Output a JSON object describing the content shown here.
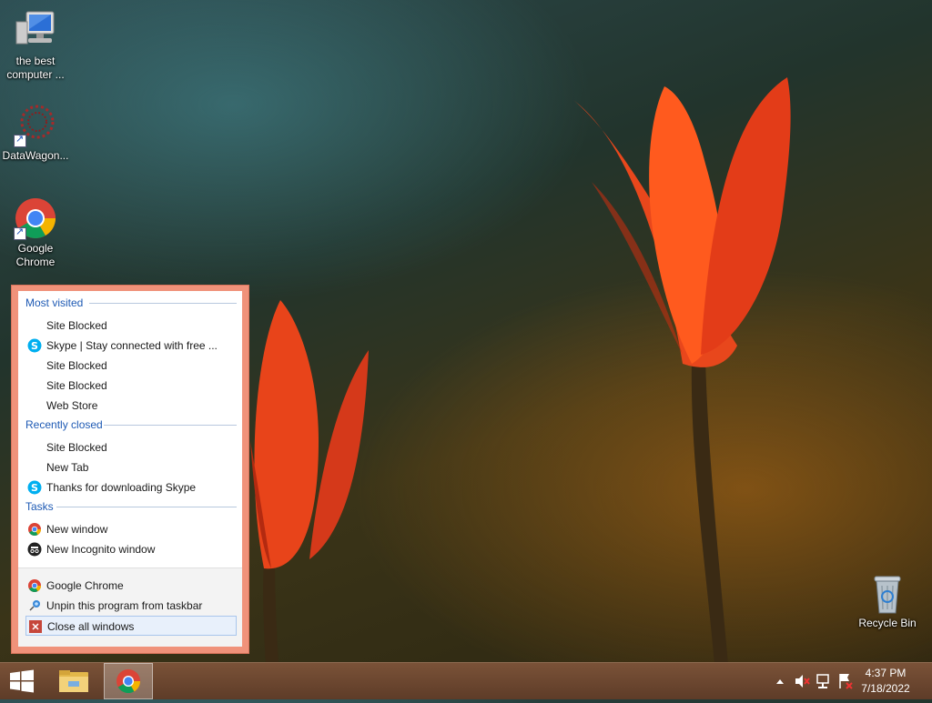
{
  "desktop": {
    "icons": [
      {
        "name": "computer-icon",
        "label": "the best computer ..."
      },
      {
        "name": "datawagon-icon",
        "label": "DataWagon..."
      },
      {
        "name": "chrome-icon",
        "label": "Google Chrome"
      },
      {
        "name": "recycle-bin-icon",
        "label": "Recycle Bin"
      }
    ]
  },
  "jumplist": {
    "most_visited_header": "Most visited",
    "most_visited": [
      {
        "label": "Site Blocked",
        "icon": ""
      },
      {
        "label": "Skype | Stay connected with free ...",
        "icon": "skype-icon"
      },
      {
        "label": "Site Blocked",
        "icon": ""
      },
      {
        "label": "Site Blocked",
        "icon": ""
      },
      {
        "label": "Web Store",
        "icon": ""
      }
    ],
    "recently_closed_header": "Recently closed",
    "recently_closed": [
      {
        "label": "Site Blocked",
        "icon": ""
      },
      {
        "label": "New Tab",
        "icon": ""
      },
      {
        "label": "Thanks for downloading Skype",
        "icon": "skype-icon"
      }
    ],
    "tasks_header": "Tasks",
    "tasks": [
      {
        "label": "New window",
        "icon": "chrome-icon"
      },
      {
        "label": "New Incognito window",
        "icon": "incognito-icon"
      }
    ],
    "footer": [
      {
        "label": "Google Chrome",
        "icon": "chrome-icon"
      },
      {
        "label": "Unpin this program from taskbar",
        "icon": "unpin-icon"
      },
      {
        "label": "Close all windows",
        "icon": "close-icon"
      }
    ]
  },
  "taskbar": {
    "time": "4:37 PM",
    "date": "7/18/2022"
  },
  "colors": {
    "jumplist_border": "#f0927a",
    "section_header": "#1e5ab4",
    "taskbar": "#6a4530"
  }
}
